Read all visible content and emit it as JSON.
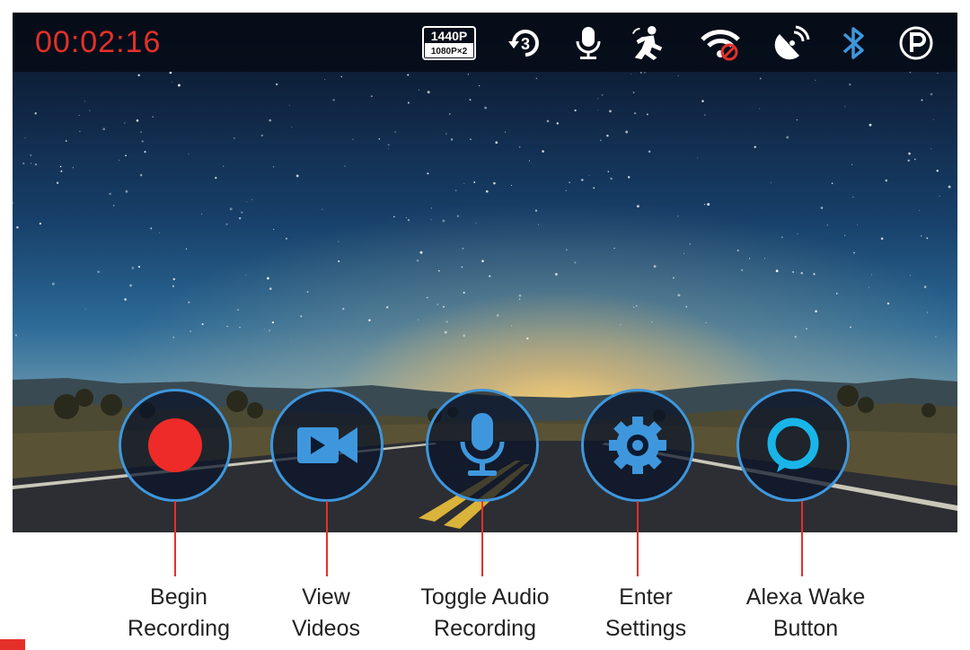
{
  "status": {
    "timer": "00:02:16",
    "resolution_primary": "1440P",
    "resolution_secondary": "1080P×2",
    "loop_minutes": "3",
    "icons": [
      "resolution-badge-icon",
      "loop-recording-icon",
      "microphone-icon",
      "motion-detection-icon",
      "wifi-off-icon",
      "gps-icon",
      "bluetooth-icon",
      "parking-mode-icon"
    ]
  },
  "colors": {
    "accent": "#3e97dd",
    "record": "#e53029",
    "alexa": "#19b5e9",
    "timer": "#e53029"
  },
  "controls": [
    {
      "id": "begin-recording",
      "icon": "record-dot-icon",
      "line1": "Begin",
      "line2": "Recording"
    },
    {
      "id": "view-videos",
      "icon": "video-camera-icon",
      "line1": "View",
      "line2": "Videos"
    },
    {
      "id": "toggle-audio",
      "icon": "microphone-icon",
      "line1": "Toggle Audio",
      "line2": "Recording"
    },
    {
      "id": "enter-settings",
      "icon": "gear-icon",
      "line1": "Enter",
      "line2": "Settings"
    },
    {
      "id": "alexa-wake",
      "icon": "alexa-ring-icon",
      "line1": "Alexa Wake",
      "line2": "Button"
    }
  ]
}
